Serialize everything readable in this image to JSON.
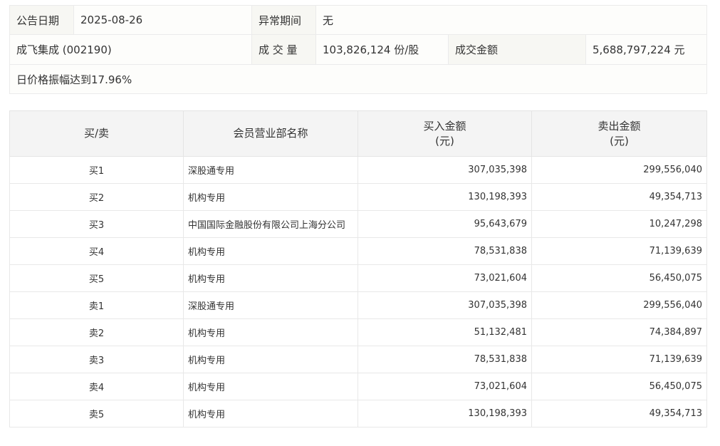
{
  "info": {
    "announce_date_label": "公告日期",
    "announce_date_value": "2025-08-26",
    "abnormal_period_label": "异常期间",
    "abnormal_period_value": "无",
    "stock_name": "成飞集成 (002190)",
    "volume_label": "成 交 量",
    "volume_value": "103,826,124 份/股",
    "turnover_label": "成交金额",
    "turnover_value": "5,688,797,224 元",
    "reason": "日价格振幅达到17.96%"
  },
  "trade": {
    "headers": {
      "side": "买/卖",
      "branch": "会员营业部名称",
      "buy_amount_line1": "买入金额",
      "buy_amount_line2": "(元)",
      "sell_amount_line1": "卖出金额",
      "sell_amount_line2": "(元)"
    },
    "rows": [
      {
        "side": "买1",
        "branch": "深股通专用",
        "buy": "307,035,398",
        "sell": "299,556,040"
      },
      {
        "side": "买2",
        "branch": "机构专用",
        "buy": "130,198,393",
        "sell": "49,354,713"
      },
      {
        "side": "买3",
        "branch": "中国国际金融股份有限公司上海分公司",
        "buy": "95,643,679",
        "sell": "10,247,298"
      },
      {
        "side": "买4",
        "branch": "机构专用",
        "buy": "78,531,838",
        "sell": "71,139,639"
      },
      {
        "side": "买5",
        "branch": "机构专用",
        "buy": "73,021,604",
        "sell": "56,450,075"
      },
      {
        "side": "卖1",
        "branch": "深股通专用",
        "buy": "307,035,398",
        "sell": "299,556,040"
      },
      {
        "side": "卖2",
        "branch": "机构专用",
        "buy": "51,132,481",
        "sell": "74,384,897"
      },
      {
        "side": "卖3",
        "branch": "机构专用",
        "buy": "78,531,838",
        "sell": "71,139,639"
      },
      {
        "side": "卖4",
        "branch": "机构专用",
        "buy": "73,021,604",
        "sell": "56,450,075"
      },
      {
        "side": "卖5",
        "branch": "机构专用",
        "buy": "130,198,393",
        "sell": "49,354,713"
      }
    ]
  }
}
